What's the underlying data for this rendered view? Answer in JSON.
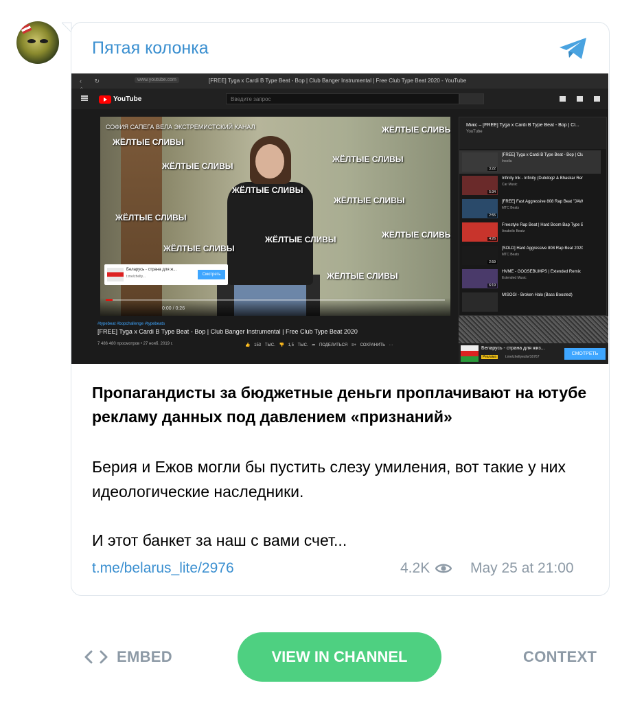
{
  "channel": {
    "name": "Пятая колонка",
    "avatar_icon": "channel-avatar",
    "telegram_icon": "telegram-plane-icon",
    "accent_color": "#3a8fd0"
  },
  "media": {
    "browser": {
      "url": "www.youtube.com",
      "tab_title": "[FREE] Tyga x Cardi B Type Beat - Bop | Club Banger Instrumental | Free Club Type Beat 2020 - YouTube"
    },
    "youtube": {
      "logo_text": "YouTube",
      "search_placeholder": "Введите запрос"
    },
    "video": {
      "top_caption": "СОФИЯ САПЕГА ВЕЛА ЭКСТРЕМИСТСКИЙ КАНАЛ",
      "watermark": "ЖЁЛТЫЕ СЛИВЫ",
      "ad_title": "Беларусь - страна для ж...",
      "ad_link": "t.me/zhelty...",
      "ad_button": "Смотреть",
      "time": "0:00 / 0:26",
      "progress": 0.02
    },
    "meta": {
      "tags": "#typebeat #bopchallenge #typebeats",
      "title": "[FREE] Tyga x Cardi B Type Beat - Bop | Club Banger Instrumental | Free Club Type Beat 2020",
      "stats": "7 486 480 просмотров • 27 нояб. 2019 г.",
      "actions": "👍 153 ТЫС.   👎 1,5 ТЫС.   ➦ ПОДЕЛИТЬСЯ   ≡+ СОХРАНИТЬ   ···"
    },
    "playlist": {
      "title": "Микс – [FREE] Tyga x Cardi B Type Beat - Bop | Cl...",
      "subtitle": "YouTube",
      "items": [
        {
          "title": "[FREE] Tyga x Cardi B Type Beat - Bop | Club Banger...",
          "channel": "Insoila",
          "duration": "3:22"
        },
        {
          "title": "Infinity Ink - Infinity (Dubdogz & Bhaskar Remix) (Bass...",
          "channel": "Car Music",
          "duration": "5:34"
        },
        {
          "title": "[FREE] Fast Aggressive 808 Rap Beat \"JAWS\" | Dark Hip...",
          "channel": "MTC Beats",
          "duration": "2:55"
        },
        {
          "title": "Freestyle Rap Beat | Hard Boom Bap Type Beat | Hip...",
          "channel": "Anabolic Beatz",
          "duration": "4:26"
        },
        {
          "title": "[SOLD] Hard Aggressive 808 Rap Beat 2020 \"DEADPOO...",
          "channel": "MTC Beats",
          "duration": "2:59"
        },
        {
          "title": "HVME - GOOSEBUMPS | Extended Remix",
          "channel": "Extended Music",
          "duration": "6:19"
        },
        {
          "title": "MISOGI - Broken Halo (Bass Boosted)",
          "channel": "",
          "duration": ""
        }
      ]
    },
    "ad_bottom": {
      "title": "Беларусь - страна для жиз...",
      "label": "Реклама",
      "link": "t.me/zheltyesliv/16767",
      "button": "СМОТРЕТЬ"
    }
  },
  "post": {
    "headline": "Пропагандисты за бюджетные деньги проплачивают на ютубе рекламу данных под давлением «признаний»",
    "paragraph1": "Берия и Ежов могли бы пустить слезу умиления, вот такие у них идеологические наследники.",
    "paragraph2": "И этот банкет за наш с вами счет...",
    "link": "t.me/belarus_lite/2976",
    "views": "4.2K",
    "date": "May 25 at 21:00"
  },
  "footer": {
    "embed_label": "EMBED",
    "view_label": "VIEW IN CHANNEL",
    "context_label": "CONTEXT",
    "view_color": "#4ed081"
  }
}
